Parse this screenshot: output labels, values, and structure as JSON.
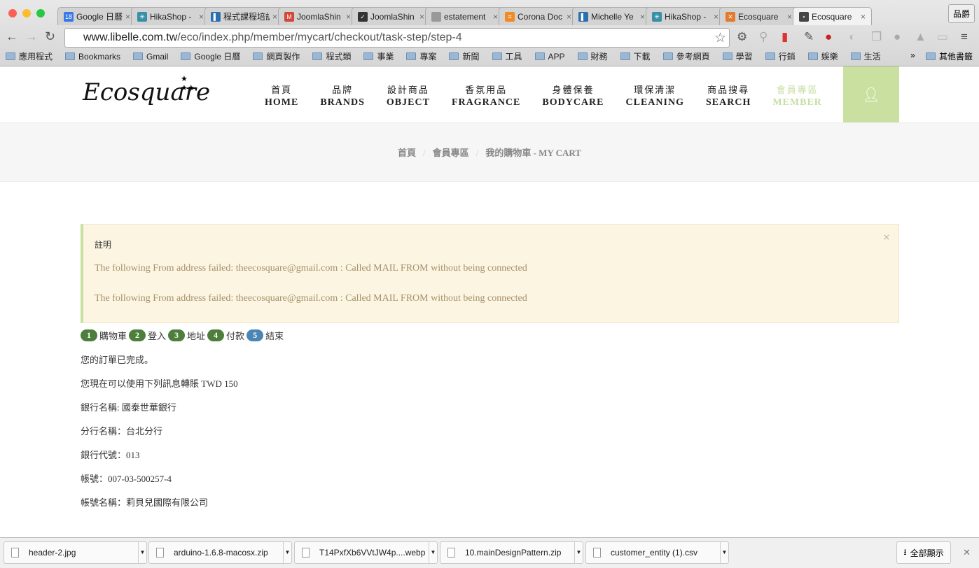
{
  "browser": {
    "tabs": [
      {
        "title": "Google 日曆",
        "color": "#3b78e7",
        "fav": "18"
      },
      {
        "title": "HikaShop -",
        "color": "#3a8fa8",
        "fav": "✳"
      },
      {
        "title": "程式課程培訓",
        "color": "#2a6fb0",
        "fav": "▌"
      },
      {
        "title": "JoomlaShin",
        "color": "#d44638",
        "fav": "M"
      },
      {
        "title": "JoomlaShin",
        "color": "#333",
        "fav": "✓"
      },
      {
        "title": "estatement",
        "color": "#999",
        "fav": ""
      },
      {
        "title": "Corona Doc",
        "color": "#f08a24",
        "fav": "≡"
      },
      {
        "title": "Michelle Ye",
        "color": "#2a6fb0",
        "fav": "▌"
      },
      {
        "title": "HikaShop -",
        "color": "#3a8fa8",
        "fav": "✳"
      },
      {
        "title": "Ecosquare",
        "color": "#e27b2d",
        "fav": "✕"
      },
      {
        "title": "Ecosquare",
        "color": "#444",
        "fav": "⋆"
      }
    ],
    "profile": "品爵",
    "url_host": "www.libelle.com.tw",
    "url_path": "/eco/index.php/member/mycart/checkout/task-step/step-4",
    "bookmarks": [
      "應用程式",
      "Bookmarks",
      "Gmail",
      "Google 日曆",
      "網頁製作",
      "程式類",
      "事業",
      "專案",
      "新聞",
      "工具",
      "APP",
      "財務",
      "下載",
      "參考網頁",
      "學習",
      "行銷",
      "娛樂",
      "生活"
    ],
    "bookmarks_more": "»",
    "other_bookmarks": "其他書籤"
  },
  "site": {
    "logo": "Ecosquare",
    "menu": [
      {
        "zh": "首頁",
        "en": "HOME"
      },
      {
        "zh": "品牌",
        "en": "BRANDS"
      },
      {
        "zh": "設計商品",
        "en": "OBJECT"
      },
      {
        "zh": "香氛用品",
        "en": "FRAGRANCE"
      },
      {
        "zh": "身體保養",
        "en": "BODYCARE"
      },
      {
        "zh": "環保清潔",
        "en": "CLEANING"
      },
      {
        "zh": "商品搜尋",
        "en": "SEARCH"
      },
      {
        "zh": "會員專區",
        "en": "MEMBER"
      }
    ],
    "breadcrumb": [
      "首頁",
      "會員專區",
      "我的購物車 - MY CART"
    ]
  },
  "alert": {
    "title": "註明",
    "messages": [
      "The following From address failed: theecosquare@gmail.com : Called MAIL FROM without being connected",
      "The following From address failed: theecosquare@gmail.com : Called MAIL FROM without being connected"
    ]
  },
  "steps": [
    {
      "n": "1",
      "label": "購物車"
    },
    {
      "n": "2",
      "label": "登入"
    },
    {
      "n": "3",
      "label": "地址"
    },
    {
      "n": "4",
      "label": "付款"
    },
    {
      "n": "5",
      "label": "結束"
    }
  ],
  "content": [
    "您的訂單已完成。",
    "您現在可以使用下列訊息轉賬 TWD 150",
    "銀行名稱: 國泰世華銀行",
    "分行名稱：台北分行",
    "銀行代號：013",
    "帳號：007-03-500257-4",
    "帳號名稱：莉貝兒國際有限公司"
  ],
  "downloads": {
    "files": [
      "header-2.jpg",
      "arduino-1.6.8-macosx.zip",
      "T14PxfXb6VVtJW4p....webp",
      "10.mainDesignPattern.zip",
      "customer_entity (1).csv"
    ],
    "show_all": "全部顯示"
  }
}
